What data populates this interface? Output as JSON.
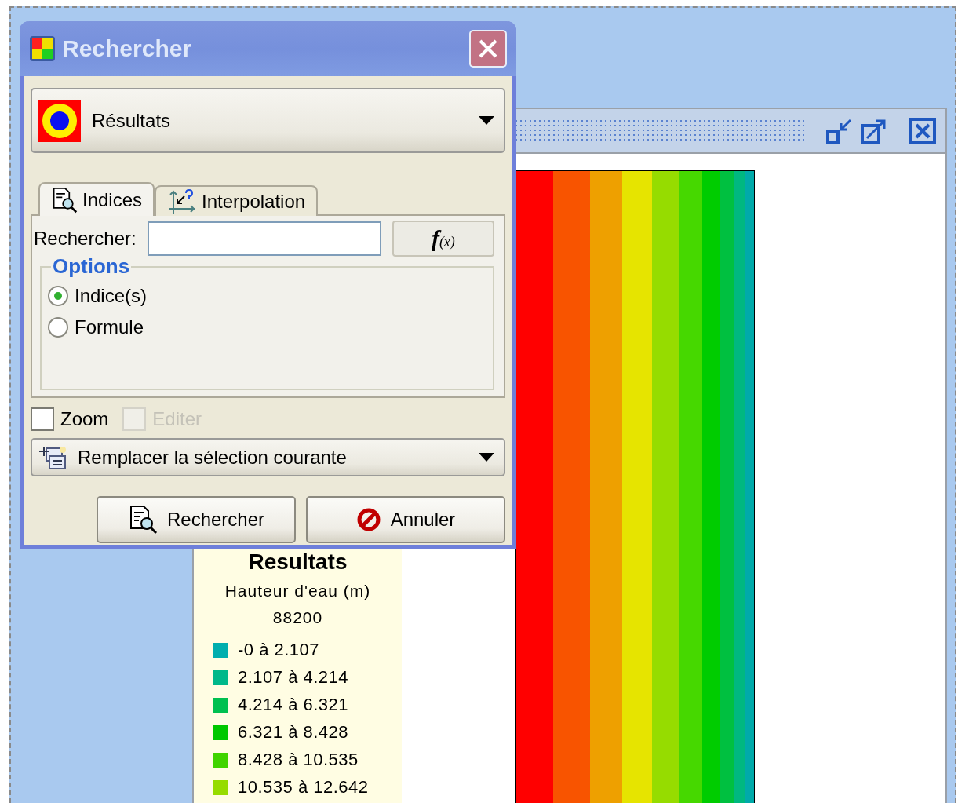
{
  "dialog": {
    "title": "Rechercher",
    "layer_select": {
      "value": "Résultats"
    },
    "tabs": [
      {
        "label": "Indices",
        "selected": true
      },
      {
        "label": "Interpolation",
        "selected": false
      }
    ],
    "search": {
      "label": "Rechercher:",
      "formula_button": "f(x)"
    },
    "options": {
      "title": "Options",
      "choices": [
        {
          "label": "Indice(s)",
          "selected": true
        },
        {
          "label": "Formule",
          "selected": false
        }
      ]
    },
    "checkboxes": [
      {
        "label": "Zoom",
        "checked": false,
        "disabled": false
      },
      {
        "label": "Editer",
        "checked": false,
        "disabled": true
      }
    ],
    "selection_mode": {
      "value": "Remplacer la sélection courante"
    },
    "buttons": [
      {
        "label": "Rechercher",
        "kind": "search"
      },
      {
        "label": "Annuler",
        "kind": "cancel"
      }
    ]
  },
  "legend": {
    "title": "Resultats",
    "variable": "Hauteur d'eau (m)",
    "time": "88200",
    "items": [
      {
        "label": "-0 à 2.107",
        "color": "#00aeae"
      },
      {
        "label": "2.107 à 4.214",
        "color": "#00b88a"
      },
      {
        "label": "4.214 à 6.321",
        "color": "#00c050"
      },
      {
        "label": "6.321 à 8.428",
        "color": "#00c800"
      },
      {
        "label": "8.428 à 10.535",
        "color": "#40d400"
      },
      {
        "label": "10.535 à 12.642",
        "color": "#96dc00"
      }
    ]
  }
}
